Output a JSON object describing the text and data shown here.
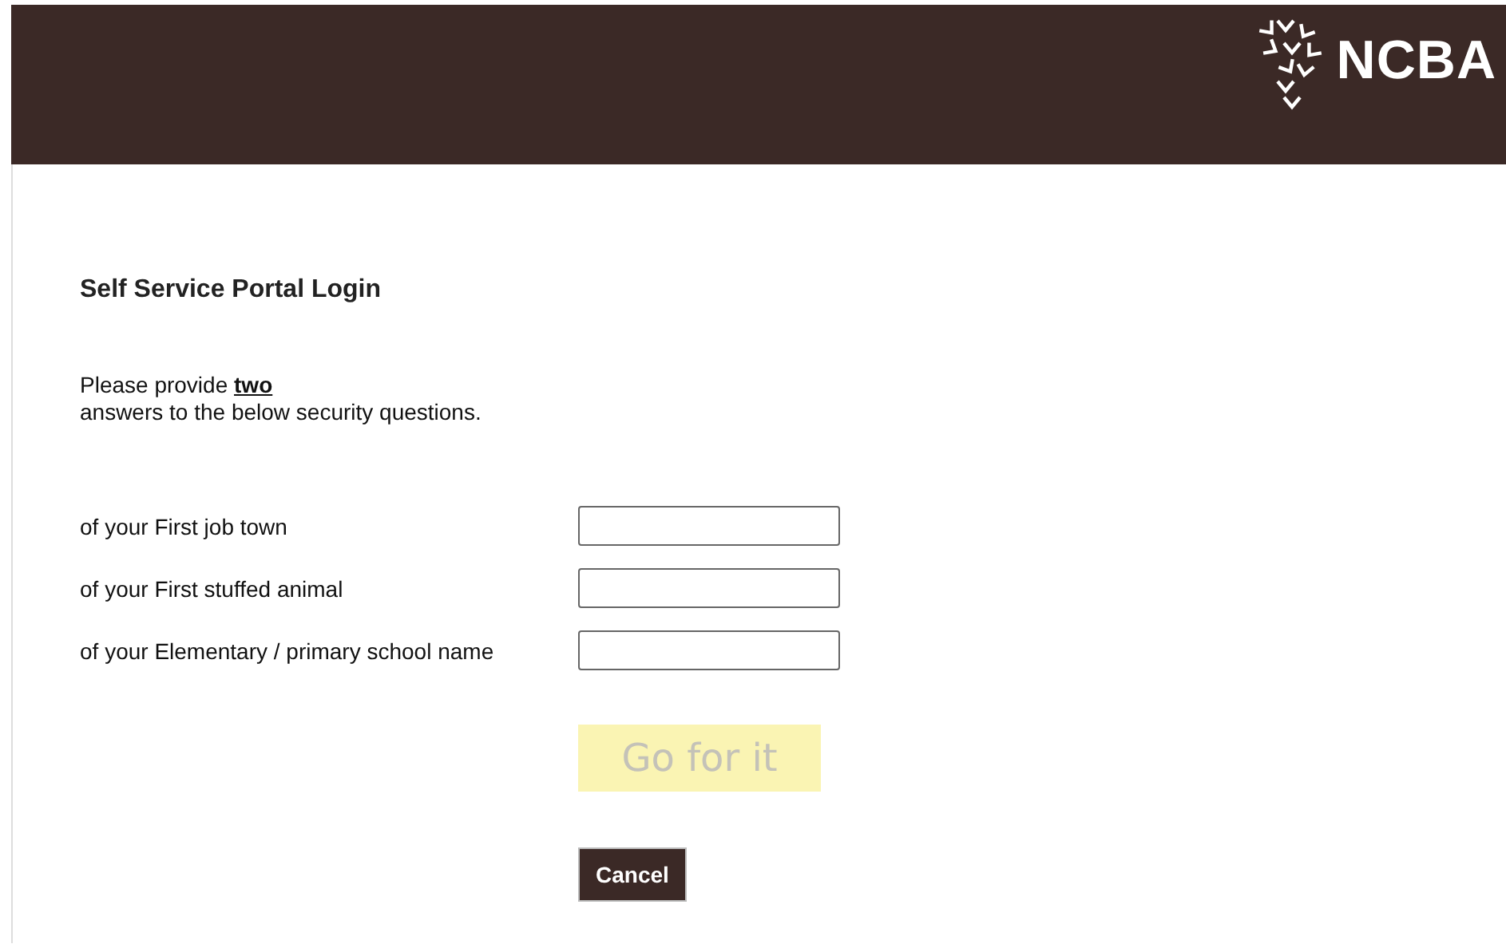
{
  "header": {
    "logo_text": "NCBA"
  },
  "title": "Self Service Portal Login",
  "intro": {
    "first_line": "Please provide **two**",
    "second_line": "answers to the below security questions."
  },
  "questions": [
    {
      "label": "of your First job town"
    },
    {
      "label": "of your First stuffed animal"
    },
    {
      "label": "of your Elementary / primary school name"
    }
  ],
  "submit": {
    "label": "Go for it",
    "disabled": true
  },
  "cancel": {
    "label": "Cancel"
  }
}
